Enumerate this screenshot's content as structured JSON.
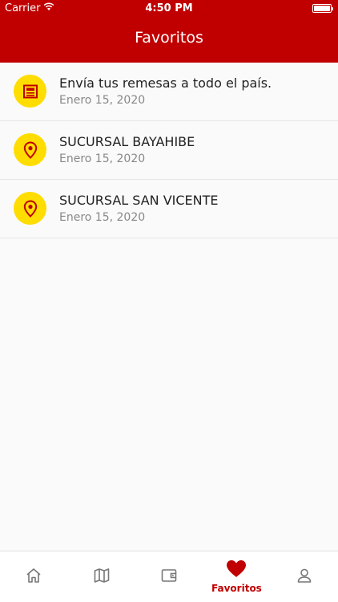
{
  "status_bar": {
    "carrier": "Carrier",
    "time": "4:50 PM"
  },
  "header": {
    "title": "Favoritos"
  },
  "favorites": [
    {
      "title": "Envía tus remesas a todo el país.",
      "date": "Enero 15, 2020",
      "icon": "news-icon"
    },
    {
      "title": "SUCURSAL BAYAHIBE",
      "date": "Enero 15, 2020",
      "icon": "location-pin-icon"
    },
    {
      "title": "SUCURSAL SAN VICENTE",
      "date": "Enero 15, 2020",
      "icon": "location-pin-icon"
    }
  ],
  "tabbar": {
    "active_label": "Favoritos",
    "tabs": [
      "home-icon",
      "map-icon",
      "wallet-icon",
      "heart-icon",
      "profile-icon"
    ]
  },
  "colors": {
    "primary": "#c00000",
    "accent_yellow": "#ffdd00",
    "icon_gray": "#777777"
  }
}
